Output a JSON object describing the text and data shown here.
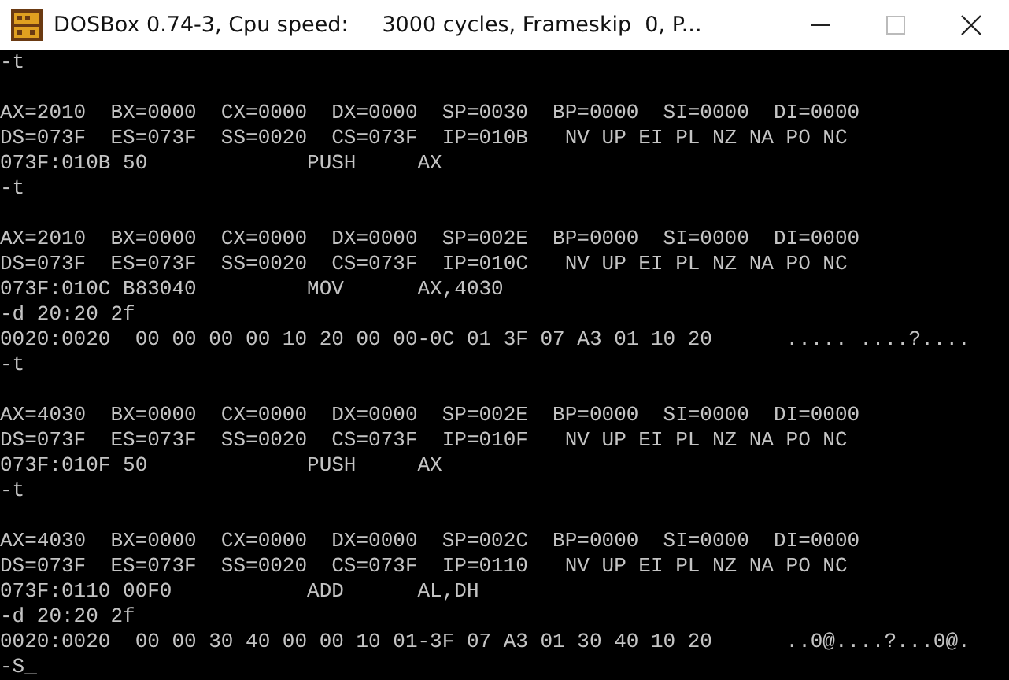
{
  "window": {
    "title": "DOSBox 0.74-3, Cpu speed:     3000 cycles, Frameskip  0, P..."
  },
  "console": {
    "lines": [
      {
        "kind": "text",
        "text": "-t"
      },
      {
        "kind": "blank"
      },
      {
        "kind": "text",
        "text": "AX=2010  BX=0000  CX=0000  DX=0000  SP=0030  BP=0000  SI=0000  DI=0000"
      },
      {
        "kind": "text",
        "text": "DS=073F  ES=073F  SS=0020  CS=073F  IP=010B   NV UP EI PL NZ NA PO NC"
      },
      {
        "kind": "text",
        "text": "073F:010B 50             PUSH     AX"
      },
      {
        "kind": "text",
        "text": "-t"
      },
      {
        "kind": "blank"
      },
      {
        "kind": "text",
        "text": "AX=2010  BX=0000  CX=0000  DX=0000  SP=002E  BP=0000  SI=0000  DI=0000"
      },
      {
        "kind": "text",
        "text": "DS=073F  ES=073F  SS=0020  CS=073F  IP=010C   NV UP EI PL NZ NA PO NC"
      },
      {
        "kind": "text",
        "text": "073F:010C B83040         MOV      AX,4030"
      },
      {
        "kind": "text",
        "text": "-d 20:20 2f"
      },
      {
        "kind": "text",
        "text": "0020:0020  00 00 00 00 10 20 00 00-0C 01 3F 07 A3 01 10 20      ..... ....?...."
      },
      {
        "kind": "text",
        "text": "-t"
      },
      {
        "kind": "blank"
      },
      {
        "kind": "text",
        "text": "AX=4030  BX=0000  CX=0000  DX=0000  SP=002E  BP=0000  SI=0000  DI=0000"
      },
      {
        "kind": "text",
        "text": "DS=073F  ES=073F  SS=0020  CS=073F  IP=010F   NV UP EI PL NZ NA PO NC"
      },
      {
        "kind": "text",
        "text": "073F:010F 50             PUSH     AX"
      },
      {
        "kind": "text",
        "text": "-t"
      },
      {
        "kind": "blank"
      },
      {
        "kind": "text",
        "text": "AX=4030  BX=0000  CX=0000  DX=0000  SP=002C  BP=0000  SI=0000  DI=0000"
      },
      {
        "kind": "text",
        "text": "DS=073F  ES=073F  SS=0020  CS=073F  IP=0110   NV UP EI PL NZ NA PO NC"
      },
      {
        "kind": "text",
        "text": "073F:0110 00F0           ADD      AL,DH"
      },
      {
        "kind": "text",
        "text": "-d 20:20 2f"
      },
      {
        "kind": "text",
        "text": "0020:0020  00 00 30 40 00 00 10 01-3F 07 A3 01 30 40 10 20      ..0@....?...0@."
      },
      {
        "kind": "text",
        "text": "-S_"
      }
    ]
  }
}
